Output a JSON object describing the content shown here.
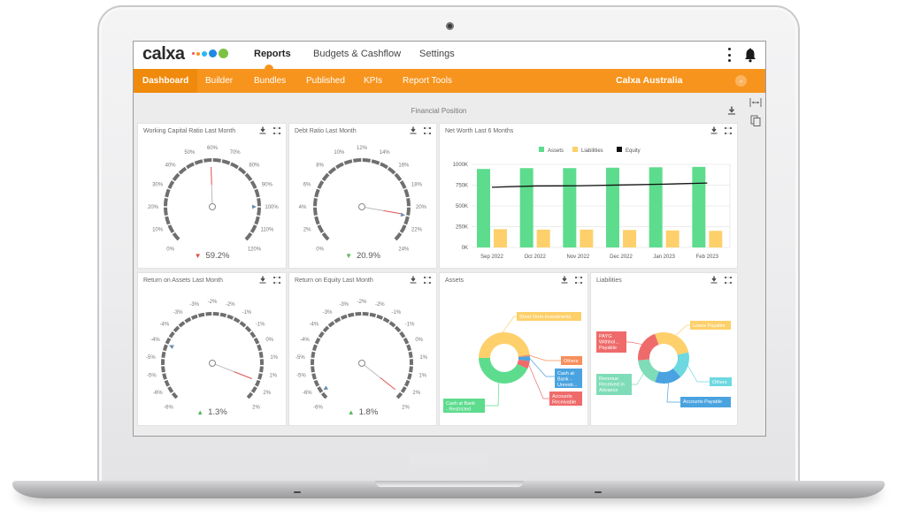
{
  "app": {
    "logo_text": "calxa",
    "logo_dot_colors": [
      "#ef5350",
      "#f7941d",
      "#29b6f6",
      "#1e88e5",
      "#7cc242"
    ],
    "accent_color": "#f7941d"
  },
  "top_nav": {
    "items": [
      {
        "label": "Reports",
        "active": true
      },
      {
        "label": "Budgets & Cashflow",
        "active": false
      },
      {
        "label": "Settings",
        "active": false
      }
    ],
    "more_icon": "kebab-icon",
    "notification_icon": "bell-icon"
  },
  "sub_nav": {
    "items": [
      {
        "label": "Dashboard",
        "active": true
      },
      {
        "label": "Builder",
        "active": false
      },
      {
        "label": "Bundles",
        "active": false
      },
      {
        "label": "Published",
        "active": false
      },
      {
        "label": "KPIs",
        "active": false
      },
      {
        "label": "Report Tools",
        "active": false
      }
    ],
    "organization": "Calxa Australia",
    "org_dropdown_icon": "chevron-down-icon"
  },
  "side_tools": [
    "fit-width-icon",
    "copy-icon"
  ],
  "section": {
    "title": "Financial Position",
    "download_icon": "download-icon"
  },
  "cards": {
    "wcr": {
      "title": "Working Capital Ratio Last Month",
      "ticks": [
        "0%",
        "10%",
        "20%",
        "30%",
        "40%",
        "50%",
        "60%",
        "70%",
        "80%",
        "90%",
        "100%",
        "110%",
        "120%"
      ],
      "min": 0,
      "max": 120,
      "value": 59.2,
      "target": 100,
      "display": "59.2%",
      "trend": "down",
      "trend_color": "#d9534f"
    },
    "debt": {
      "title": "Debt Ratio Last Month",
      "ticks": [
        "0%",
        "2%",
        "4%",
        "6%",
        "8%",
        "10%",
        "12%",
        "14%",
        "16%",
        "18%",
        "20%",
        "22%",
        "24%"
      ],
      "min": 0,
      "max": 24,
      "value": 20.9,
      "target": 21,
      "display": "20.9%",
      "trend": "down",
      "trend_color": "#5cb85c"
    },
    "roa": {
      "title": "Return on Assets Last Month",
      "ticks": [
        "-6%",
        "-6%",
        "-5%",
        "-5%",
        "-4%",
        "-4%",
        "-3%",
        "-3%",
        "-2%",
        "-2%",
        "-1%",
        "-1%",
        "0%",
        "1%",
        "1%",
        "2%",
        "2%"
      ],
      "min": -6,
      "max": 2,
      "value": 1.3,
      "target": -4,
      "display": "1.3%",
      "trend": "up",
      "trend_color": "#5cb85c"
    },
    "roe": {
      "title": "Return on Equity Last Month",
      "ticks": [
        "-6%",
        "-6%",
        "-5%",
        "-5%",
        "-4%",
        "-4%",
        "-3%",
        "-3%",
        "-2%",
        "-2%",
        "-1%",
        "-1%",
        "0%",
        "1%",
        "1%",
        "2%",
        "2%"
      ],
      "min": -6,
      "max": 2,
      "value": 1.8,
      "target": -5.7,
      "display": "1.8%",
      "trend": "up",
      "trend_color": "#5cb85c"
    },
    "networth": {
      "title": "Net Worth Last 6 Months"
    },
    "assets": {
      "title": "Assets"
    },
    "liabilities": {
      "title": "Liabilities"
    }
  },
  "card_tools": {
    "download_icon": "download-icon",
    "expand_icon": "expand-icon"
  },
  "chart_data": [
    {
      "type": "bar",
      "title": "Net Worth Last 6 Months",
      "categories": [
        "Sep 2022",
        "Oct 2022",
        "Nov 2022",
        "Dec 2022",
        "Jan 2023",
        "Feb 2023"
      ],
      "series": [
        {
          "name": "Assets",
          "kind": "bar",
          "color": "#5ddc8e",
          "values": [
            945000,
            955000,
            955000,
            960000,
            965000,
            970000
          ]
        },
        {
          "name": "Liabilities",
          "kind": "bar",
          "color": "#fdd06b",
          "values": [
            220000,
            215000,
            215000,
            210000,
            205000,
            200000
          ]
        },
        {
          "name": "Equity",
          "kind": "line",
          "color": "#111111",
          "values": [
            725000,
            740000,
            742000,
            752000,
            762000,
            775000
          ]
        }
      ],
      "yticks": [
        "0K",
        "250K",
        "500K",
        "750K",
        "1000K"
      ],
      "ylim": [
        0,
        1000000
      ],
      "legend": "top",
      "grid": true
    },
    {
      "type": "pie",
      "title": "Assets",
      "slices": [
        {
          "label": "Short-Term Investments",
          "value": 48,
          "color": "#fdd06b"
        },
        {
          "label": "Others",
          "value": 1,
          "color": "#f78f5c"
        },
        {
          "label": "Cash at Bank - Unrestr...",
          "value": 3,
          "color": "#4aa3e0"
        },
        {
          "label": "Accounts Receivable",
          "value": 5,
          "color": "#ef6b6b"
        },
        {
          "label": "Cash at Bank - Restricted",
          "value": 43,
          "color": "#5ddc8e"
        }
      ]
    },
    {
      "type": "pie",
      "title": "Liabilities",
      "slices": [
        {
          "label": "Loans Payable",
          "value": 27,
          "color": "#fdd06b"
        },
        {
          "label": "Others",
          "value": 17,
          "color": "#6dd8e0"
        },
        {
          "label": "Accounts Payable",
          "value": 17,
          "color": "#4aa3e0"
        },
        {
          "label": "Revenue Received in Advance",
          "value": 18,
          "color": "#7fdcb8"
        },
        {
          "label": "PAYG Withhol... Payable",
          "value": 21,
          "color": "#ef6b6b"
        }
      ]
    }
  ]
}
